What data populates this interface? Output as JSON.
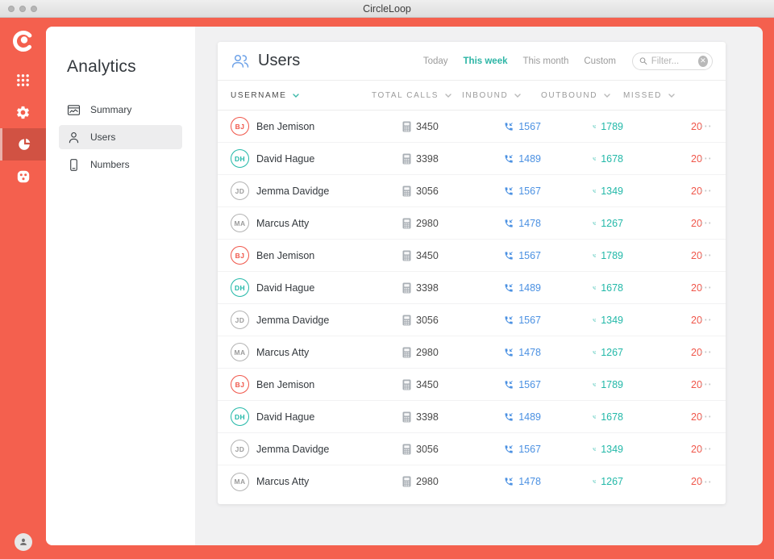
{
  "window": {
    "title": "CircleLoop"
  },
  "rail": {
    "items": [
      {
        "icon": "dialpad-grid-icon",
        "active": false
      },
      {
        "icon": "settings-gear-icon",
        "active": false
      },
      {
        "icon": "analytics-pie-icon",
        "active": true
      },
      {
        "icon": "apps-dice-icon",
        "active": false
      }
    ]
  },
  "sidebar": {
    "title": "Analytics",
    "items": [
      {
        "label": "Summary",
        "icon": "summary-chart-icon",
        "active": false
      },
      {
        "label": "Users",
        "icon": "user-icon",
        "active": true
      },
      {
        "label": "Numbers",
        "icon": "phone-icon",
        "active": false
      }
    ]
  },
  "main": {
    "title": "Users",
    "range_tabs": [
      {
        "label": "Today",
        "active": false
      },
      {
        "label": "This week",
        "active": true
      },
      {
        "label": "This month",
        "active": false
      },
      {
        "label": "Custom",
        "active": false
      }
    ],
    "filter": {
      "placeholder": "Filter..."
    },
    "table": {
      "columns": [
        {
          "label": "Username",
          "sorted": true
        },
        {
          "label": "Total calls",
          "sorted": false
        },
        {
          "label": "Inbound",
          "sorted": false
        },
        {
          "label": "Outbound",
          "sorted": false
        },
        {
          "label": "Missed",
          "sorted": false
        }
      ],
      "rows": [
        {
          "initials": "BJ",
          "color": "red",
          "name": "Ben Jemison",
          "total": "3450",
          "inbound": "1567",
          "outbound": "1789",
          "missed": "20"
        },
        {
          "initials": "DH",
          "color": "teal",
          "name": "David Hague",
          "total": "3398",
          "inbound": "1489",
          "outbound": "1678",
          "missed": "20"
        },
        {
          "initials": "JD",
          "color": "gray",
          "name": "Jemma Davidge",
          "total": "3056",
          "inbound": "1567",
          "outbound": "1349",
          "missed": "20"
        },
        {
          "initials": "MA",
          "color": "gray",
          "name": "Marcus Atty",
          "total": "2980",
          "inbound": "1478",
          "outbound": "1267",
          "missed": "20"
        },
        {
          "initials": "BJ",
          "color": "red",
          "name": "Ben Jemison",
          "total": "3450",
          "inbound": "1567",
          "outbound": "1789",
          "missed": "20"
        },
        {
          "initials": "DH",
          "color": "teal",
          "name": "David Hague",
          "total": "3398",
          "inbound": "1489",
          "outbound": "1678",
          "missed": "20"
        },
        {
          "initials": "JD",
          "color": "gray",
          "name": "Jemma Davidge",
          "total": "3056",
          "inbound": "1567",
          "outbound": "1349",
          "missed": "20"
        },
        {
          "initials": "MA",
          "color": "gray",
          "name": "Marcus Atty",
          "total": "2980",
          "inbound": "1478",
          "outbound": "1267",
          "missed": "20"
        },
        {
          "initials": "BJ",
          "color": "red",
          "name": "Ben Jemison",
          "total": "3450",
          "inbound": "1567",
          "outbound": "1789",
          "missed": "20"
        },
        {
          "initials": "DH",
          "color": "teal",
          "name": "David Hague",
          "total": "3398",
          "inbound": "1489",
          "outbound": "1678",
          "missed": "20"
        },
        {
          "initials": "JD",
          "color": "gray",
          "name": "Jemma Davidge",
          "total": "3056",
          "inbound": "1567",
          "outbound": "1349",
          "missed": "20"
        },
        {
          "initials": "MA",
          "color": "gray",
          "name": "Marcus Atty",
          "total": "2980",
          "inbound": "1478",
          "outbound": "1267",
          "missed": "20"
        }
      ],
      "row_actions_glyph": "⋯"
    }
  },
  "colors": {
    "accent_orange": "#f4604e",
    "inbound_blue": "#4a90e2",
    "outbound_teal": "#22b8a8",
    "missed_red": "#f0564a",
    "active_tab_teal": "#2cb5a5"
  }
}
